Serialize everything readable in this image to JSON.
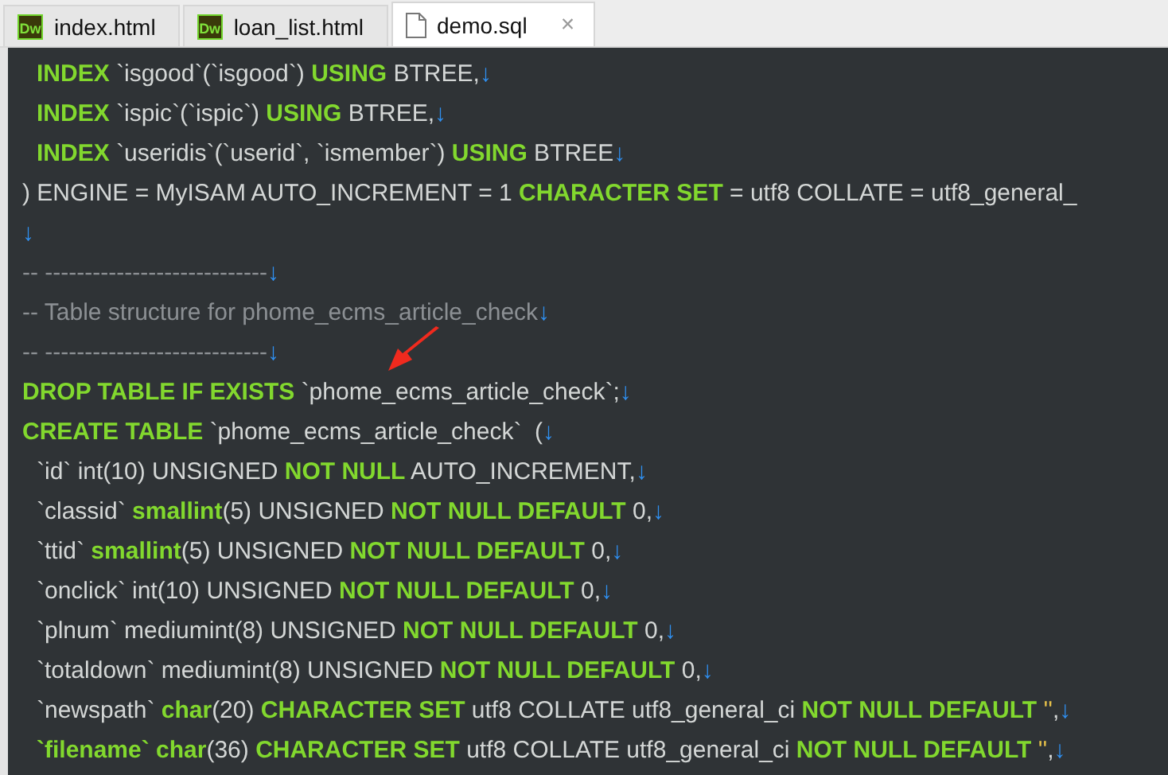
{
  "tabs": [
    {
      "kind": "dw",
      "badge": "Dw",
      "label": "index.html",
      "selected": false
    },
    {
      "kind": "dw",
      "badge": "Dw",
      "label": "loan_list.html",
      "selected": false
    },
    {
      "kind": "file",
      "label": "demo.sql",
      "close": "×",
      "selected": true
    }
  ],
  "editor": {
    "lines": [
      {
        "indent": true,
        "tokens": [
          {
            "kind": "keyword",
            "text": "INDEX"
          },
          {
            "kind": "plain",
            "text": " `isgood`(`isgood`) "
          },
          {
            "kind": "keyword",
            "text": "USING"
          },
          {
            "kind": "plain",
            "text": " BTREE,"
          },
          {
            "kind": "eol",
            "text": "↓"
          }
        ]
      },
      {
        "indent": true,
        "tokens": [
          {
            "kind": "keyword",
            "text": "INDEX"
          },
          {
            "kind": "plain",
            "text": " `ispic`(`ispic`) "
          },
          {
            "kind": "keyword",
            "text": "USING"
          },
          {
            "kind": "plain",
            "text": " BTREE,"
          },
          {
            "kind": "eol",
            "text": "↓"
          }
        ]
      },
      {
        "indent": true,
        "tokens": [
          {
            "kind": "keyword",
            "text": "INDEX"
          },
          {
            "kind": "plain",
            "text": " `useridis`(`userid`, `ismember`) "
          },
          {
            "kind": "keyword",
            "text": "USING"
          },
          {
            "kind": "plain",
            "text": " BTREE"
          },
          {
            "kind": "eol",
            "text": "↓"
          }
        ]
      },
      {
        "tokens": [
          {
            "kind": "plain",
            "text": ") ENGINE = MyISAM AUTO_INCREMENT = 1 "
          },
          {
            "kind": "keyword",
            "text": "CHARACTER SET"
          },
          {
            "kind": "plain",
            "text": " = utf8 COLLATE = utf8_general_"
          }
        ]
      },
      {
        "tokens": [
          {
            "kind": "eol",
            "text": "↓"
          }
        ]
      },
      {
        "tokens": [
          {
            "kind": "comment",
            "text": "-- ----------------------------"
          },
          {
            "kind": "eol",
            "text": "↓"
          }
        ]
      },
      {
        "tokens": [
          {
            "kind": "comment",
            "text": "-- Table structure for phome_ecms_article_check"
          },
          {
            "kind": "eol",
            "text": "↓"
          }
        ]
      },
      {
        "tokens": [
          {
            "kind": "comment",
            "text": "-- ----------------------------"
          },
          {
            "kind": "eol",
            "text": "↓"
          }
        ]
      },
      {
        "tokens": [
          {
            "kind": "keyword",
            "text": "DROP TABLE IF EXISTS"
          },
          {
            "kind": "plain",
            "text": " `phome_ecms_article_check`;"
          },
          {
            "kind": "eol",
            "text": "↓"
          }
        ]
      },
      {
        "tokens": [
          {
            "kind": "keyword",
            "text": "CREATE TABLE"
          },
          {
            "kind": "plain",
            "text": " `phome_ecms_article_check`  ("
          },
          {
            "kind": "eol",
            "text": "↓"
          }
        ]
      },
      {
        "indent": true,
        "tokens": [
          {
            "kind": "plain",
            "text": "`id` int(10) UNSIGNED "
          },
          {
            "kind": "keyword",
            "text": "NOT NULL"
          },
          {
            "kind": "plain",
            "text": " AUTO_INCREMENT,"
          },
          {
            "kind": "eol",
            "text": "↓"
          }
        ]
      },
      {
        "indent": true,
        "tokens": [
          {
            "kind": "plain",
            "text": "`classid` "
          },
          {
            "kind": "keyword",
            "text": "smallint"
          },
          {
            "kind": "plain",
            "text": "(5) UNSIGNED "
          },
          {
            "kind": "keyword",
            "text": "NOT NULL DEFAULT"
          },
          {
            "kind": "plain",
            "text": " 0,"
          },
          {
            "kind": "eol",
            "text": "↓"
          }
        ]
      },
      {
        "indent": true,
        "tokens": [
          {
            "kind": "plain",
            "text": "`ttid` "
          },
          {
            "kind": "keyword",
            "text": "smallint"
          },
          {
            "kind": "plain",
            "text": "(5) UNSIGNED "
          },
          {
            "kind": "keyword",
            "text": "NOT NULL DEFAULT"
          },
          {
            "kind": "plain",
            "text": " 0,"
          },
          {
            "kind": "eol",
            "text": "↓"
          }
        ]
      },
      {
        "indent": true,
        "tokens": [
          {
            "kind": "plain",
            "text": "`onclick` int(10) UNSIGNED "
          },
          {
            "kind": "keyword",
            "text": "NOT NULL DEFAULT"
          },
          {
            "kind": "plain",
            "text": " 0,"
          },
          {
            "kind": "eol",
            "text": "↓"
          }
        ]
      },
      {
        "indent": true,
        "tokens": [
          {
            "kind": "plain",
            "text": "`plnum` mediumint(8) UNSIGNED "
          },
          {
            "kind": "keyword",
            "text": "NOT NULL DEFAULT"
          },
          {
            "kind": "plain",
            "text": " 0,"
          },
          {
            "kind": "eol",
            "text": "↓"
          }
        ]
      },
      {
        "indent": true,
        "tokens": [
          {
            "kind": "plain",
            "text": "`totaldown` mediumint(8) UNSIGNED "
          },
          {
            "kind": "keyword",
            "text": "NOT NULL DEFAULT"
          },
          {
            "kind": "plain",
            "text": " 0,"
          },
          {
            "kind": "eol",
            "text": "↓"
          }
        ]
      },
      {
        "indent": true,
        "tokens": [
          {
            "kind": "plain",
            "text": "`newspath` "
          },
          {
            "kind": "keyword",
            "text": "char"
          },
          {
            "kind": "plain",
            "text": "(20) "
          },
          {
            "kind": "keyword",
            "text": "CHARACTER SET"
          },
          {
            "kind": "plain",
            "text": " utf8 COLLATE utf8_general_ci "
          },
          {
            "kind": "keyword",
            "text": "NOT NULL DEFAULT"
          },
          {
            "kind": "string",
            "text": " ''"
          },
          {
            "kind": "plain",
            "text": ","
          },
          {
            "kind": "eol",
            "text": "↓"
          }
        ]
      },
      {
        "indent": true,
        "tokens": [
          {
            "kind": "keyword",
            "text": "`filename`"
          },
          {
            "kind": "keyword",
            "text": " char"
          },
          {
            "kind": "plain",
            "text": "(36) "
          },
          {
            "kind": "keyword",
            "text": "CHARACTER SET"
          },
          {
            "kind": "plain",
            "text": " utf8 COLLATE utf8_general_ci "
          },
          {
            "kind": "keyword",
            "text": "NOT NULL DEFAULT"
          },
          {
            "kind": "string",
            "text": " ''"
          },
          {
            "kind": "plain",
            "text": ","
          },
          {
            "kind": "eol",
            "text": "↓"
          }
        ]
      }
    ]
  }
}
